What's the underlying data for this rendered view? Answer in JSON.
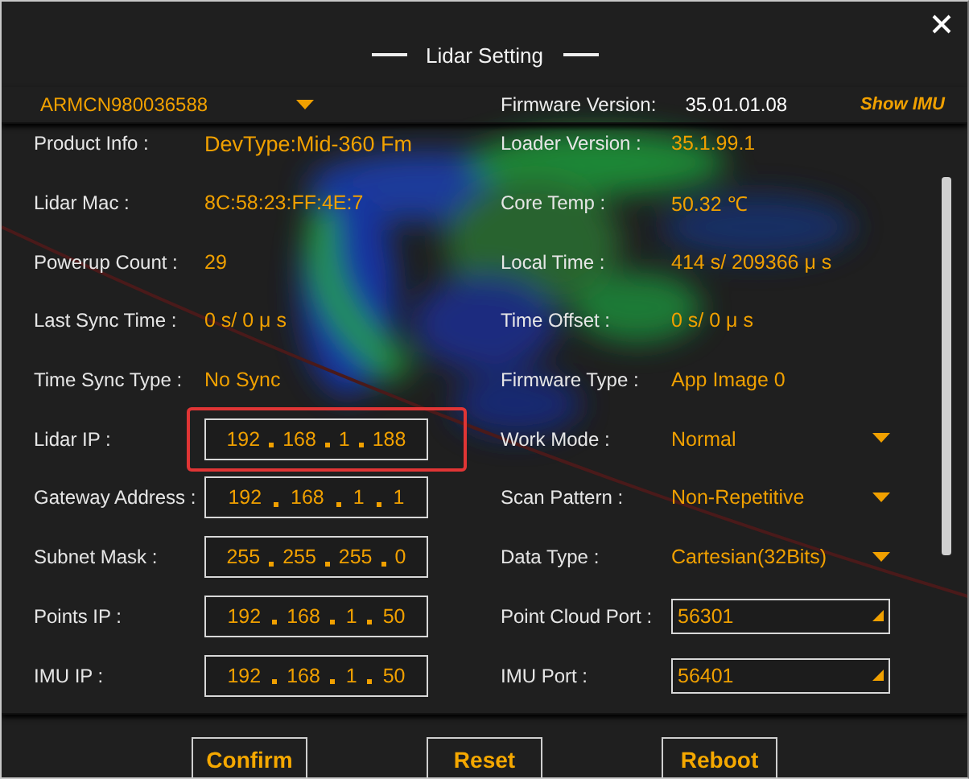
{
  "window": {
    "title": "Lidar Setting"
  },
  "header": {
    "device": "ARMCN980036588",
    "firmware_label": "Firmware Version:",
    "firmware_value": "35.01.01.08",
    "show_imu": "Show IMU"
  },
  "rows": [
    {
      "left": {
        "label": "Product Info :",
        "kind": "text",
        "value": "DevType:Mid-360 Fm"
      },
      "right": {
        "label": "Loader Version :",
        "kind": "text",
        "value": "35.1.99.1"
      }
    },
    {
      "left": {
        "label": "Lidar Mac :",
        "kind": "text",
        "value": "8C:58:23:FF:4E:7"
      },
      "right": {
        "label": "Core Temp :",
        "kind": "text",
        "value": "50.32 ℃"
      }
    },
    {
      "left": {
        "label": "Powerup Count :",
        "kind": "text",
        "value": "29"
      },
      "right": {
        "label": "Local Time :",
        "kind": "text",
        "value": "414 s/ 209366  μ s"
      }
    },
    {
      "left": {
        "label": "Last Sync Time :",
        "kind": "text",
        "value": "0 s/ 0  μ s"
      },
      "right": {
        "label": "Time Offset :",
        "kind": "text",
        "value": "0 s/ 0  μ s"
      }
    },
    {
      "left": {
        "label": "Time Sync Type :",
        "kind": "text",
        "value": "No Sync"
      },
      "right": {
        "label": "Firmware Type :",
        "kind": "text",
        "value": "App Image 0"
      }
    },
    {
      "left": {
        "label": "Lidar IP :",
        "kind": "ip",
        "octets": [
          "192",
          "168",
          "1",
          "188"
        ],
        "highlighted": true
      },
      "right": {
        "label": "Work Mode :",
        "kind": "dropdown",
        "value": "Normal"
      }
    },
    {
      "left": {
        "label": "Gateway Address :",
        "kind": "ip",
        "octets": [
          "192",
          "168",
          "1",
          "1"
        ],
        "highlighted": false
      },
      "right": {
        "label": "Scan Pattern :",
        "kind": "dropdown",
        "value": "Non-Repetitive"
      }
    },
    {
      "left": {
        "label": "Subnet Mask :",
        "kind": "ip",
        "octets": [
          "255",
          "255",
          "255",
          "0"
        ],
        "highlighted": false
      },
      "right": {
        "label": "Data Type :",
        "kind": "dropdown",
        "value": "Cartesian(32Bits)"
      }
    },
    {
      "left": {
        "label": "Points IP :",
        "kind": "ip",
        "octets": [
          "192",
          "168",
          "1",
          "50"
        ],
        "highlighted": false
      },
      "right": {
        "label": "Point Cloud Port :",
        "kind": "port",
        "value": "56301"
      }
    },
    {
      "left": {
        "label": "IMU IP :",
        "kind": "ip",
        "octets": [
          "192",
          "168",
          "1",
          "50"
        ],
        "highlighted": false
      },
      "right": {
        "label": "IMU Port :",
        "kind": "port",
        "value": "56401"
      }
    }
  ],
  "buttons": [
    "Confirm",
    "Reset",
    "Reboot"
  ]
}
